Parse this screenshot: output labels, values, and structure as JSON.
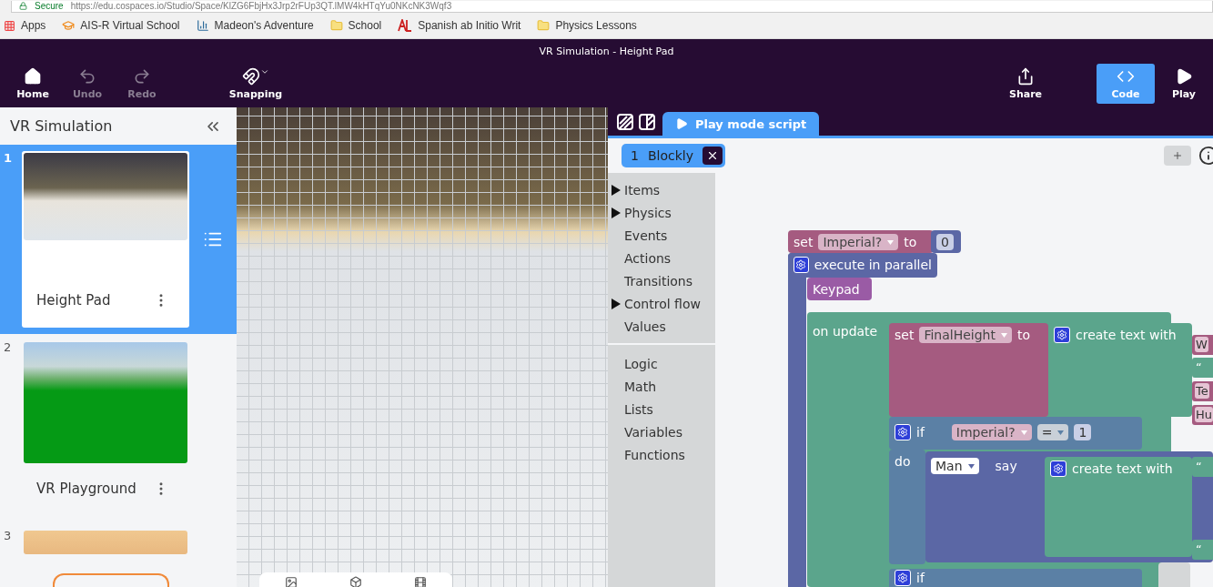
{
  "browser": {
    "secure_label": "Secure",
    "url": "https://edu.cospaces.io/Studio/Space/KlZG6FbjHx3Jrp2rFUp3QT.lMW4kHTqYu0NKcNK3Wqf3",
    "bookmarks": [
      {
        "label": "Apps",
        "kind": "apps"
      },
      {
        "label": "AIS-R Virtual School",
        "kind": "hat"
      },
      {
        "label": "Madeon's Adventure",
        "kind": "chart"
      },
      {
        "label": "School",
        "kind": "folder"
      },
      {
        "label": "Spanish ab Initio Writ",
        "kind": "logo"
      },
      {
        "label": "Physics Lessons",
        "kind": "folder"
      }
    ]
  },
  "window": {
    "title": "VR Simulation - Height Pad"
  },
  "toolbar": {
    "left": [
      {
        "label": "Home",
        "kind": "home",
        "disabled": false
      },
      {
        "label": "Undo",
        "kind": "undo",
        "disabled": true
      },
      {
        "label": "Redo",
        "kind": "redo",
        "disabled": true
      },
      {
        "label": "Snapping",
        "kind": "snapping",
        "disabled": false
      }
    ],
    "right": [
      {
        "label": "Share",
        "kind": "share",
        "selected": false
      },
      {
        "label": "Code",
        "kind": "code",
        "selected": true
      },
      {
        "label": "Play",
        "kind": "play",
        "selected": false
      }
    ]
  },
  "sidebar": {
    "title": "VR Simulation",
    "scenes": [
      {
        "number": "1",
        "name": "Height Pad",
        "selected": true,
        "kind": "town"
      },
      {
        "number": "2",
        "name": "VR Playground",
        "selected": false,
        "kind": "meadow"
      },
      {
        "number": "3",
        "selected": false,
        "kind": "desert"
      }
    ]
  },
  "code_panel": {
    "tab": "Play mode script",
    "script": {
      "number": "1",
      "name": "Blockly"
    },
    "category_groups": [
      [
        {
          "label": "Items",
          "expandable": true
        },
        {
          "label": "Physics",
          "expandable": true
        },
        {
          "label": "Events",
          "expandable": false
        },
        {
          "label": "Actions",
          "expandable": false
        },
        {
          "label": "Transitions",
          "expandable": false
        },
        {
          "label": "Control flow",
          "expandable": true
        },
        {
          "label": "Values",
          "expandable": false
        }
      ],
      [
        {
          "label": "Logic",
          "expandable": false
        },
        {
          "label": "Math",
          "expandable": false
        },
        {
          "label": "Lists",
          "expandable": false
        },
        {
          "label": "Variables",
          "expandable": false
        },
        {
          "label": "Functions",
          "expandable": false
        }
      ]
    ],
    "workspace": {
      "set_imperial": {
        "keyword": "set",
        "variable": "Imperial?",
        "connector": "to",
        "value": "0"
      },
      "execute": {
        "label": "execute in parallel"
      },
      "keypad": {
        "label": "Keypad"
      },
      "on_update": {
        "label": "on update"
      },
      "set_height": {
        "keyword": "set",
        "variable": "FinalHeight",
        "connector": "to"
      },
      "create_text": {
        "label": "create text with",
        "inputs": [
          {
            "text": "W",
            "kind": "value"
          },
          {
            "text": "“",
            "kind": "text"
          },
          {
            "text": "Te",
            "kind": "value"
          },
          {
            "text": "Hu",
            "kind": "value"
          }
        ]
      },
      "if_imperial": {
        "keyword": "if",
        "variable": "Imperial?",
        "operator": "=",
        "value": "1",
        "branch": "do"
      },
      "say": {
        "object": "Man",
        "keyword": "say"
      },
      "create_say_text": {
        "label": "create text with",
        "inputs": [
          {
            "text": "“",
            "kind": "text"
          },
          {
            "text": "“",
            "kind": "text"
          }
        ]
      },
      "if_next": {
        "keyword": "if"
      }
    }
  }
}
